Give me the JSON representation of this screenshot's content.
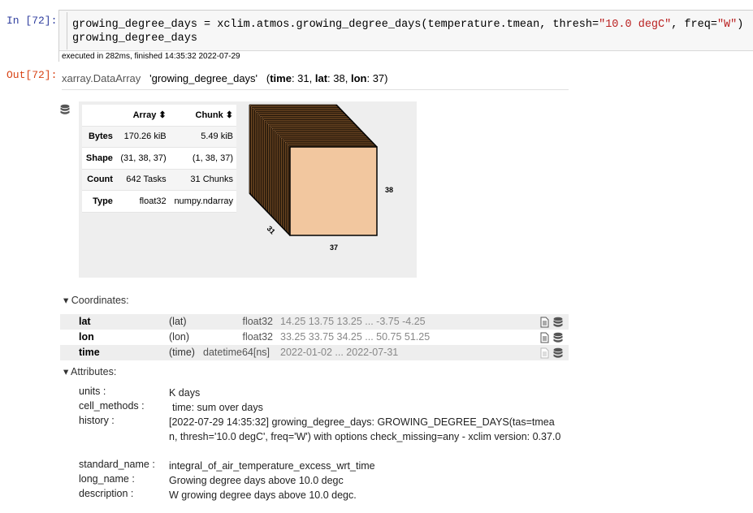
{
  "cell": {
    "in_prompt": "In [72]:",
    "out_prompt": "Out[72]:",
    "code_line1_a": "growing_degree_days = xclim.atmos.growing_degree_days(temperature.tmean, thresh=",
    "code_line1_s1": "\"10.0 degC\"",
    "code_line1_b": ", freq=",
    "code_line1_s2": "\"W\"",
    "code_line1_c": ")",
    "code_line2": "growing_degree_days",
    "exec_info": "executed in 282ms, finished 14:35:32 2022-07-29"
  },
  "header": {
    "class_name": "xarray.DataArray",
    "var_name": "'growing_degree_days'",
    "dims_open": "(",
    "dim1": "time",
    "dim1_val": ": 31, ",
    "dim2": "lat",
    "dim2_val": ": 38, ",
    "dim3": "lon",
    "dim3_val": ": 37)"
  },
  "dask_table": {
    "col_array": "Array ⬍",
    "col_chunk": "Chunk ⬍",
    "rows": [
      {
        "label": "Bytes",
        "array": "170.26 kiB",
        "chunk": "5.49 kiB"
      },
      {
        "label": "Shape",
        "array": "(31, 38, 37)",
        "chunk": "(1, 38, 37)"
      },
      {
        "label": "Count",
        "array": "642 Tasks",
        "chunk": "31 Chunks"
      },
      {
        "label": "Type",
        "array": "float32",
        "chunk": "numpy.ndarray"
      }
    ]
  },
  "cube": {
    "label_depth": "31",
    "label_height": "38",
    "label_width": "37",
    "face_color": "#f2c79f",
    "side_color": "#8b5a2b",
    "chunks": 31
  },
  "coordinates": {
    "title": "▾ Coordinates:",
    "items": [
      {
        "name": "lat",
        "dims": "(lat)",
        "dtype": "float32",
        "values": "14.25 13.75 13.25 ... -3.75 -4.25"
      },
      {
        "name": "lon",
        "dims": "(lon)",
        "dtype": "float32",
        "values": "33.25 33.75 34.25 ... 50.75 51.25"
      },
      {
        "name": "time",
        "dims": "(time)",
        "dtype": "datetime64[ns]",
        "values": "2022-01-02 ... 2022-07-31"
      }
    ]
  },
  "attributes": {
    "title": "▾ Attributes:",
    "items": [
      {
        "key": "units :",
        "value": "K days"
      },
      {
        "key": "cell_methods :",
        "value": "time: sum over days"
      },
      {
        "key": "history :",
        "value": "[2022-07-29 14:35:32] growing_degree_days: GROWING_DEGREE_DAYS(tas=tmean, thresh='10.0 degC', freq='W') with options check_missing=any - xclim version: 0.37.0"
      },
      {
        "key": "standard_name :",
        "value": "integral_of_air_temperature_excess_wrt_time"
      },
      {
        "key": "long_name :",
        "value": "Growing degree days above 10.0 degc"
      },
      {
        "key": "description :",
        "value": "W growing degree days above 10.0 degc."
      }
    ]
  }
}
